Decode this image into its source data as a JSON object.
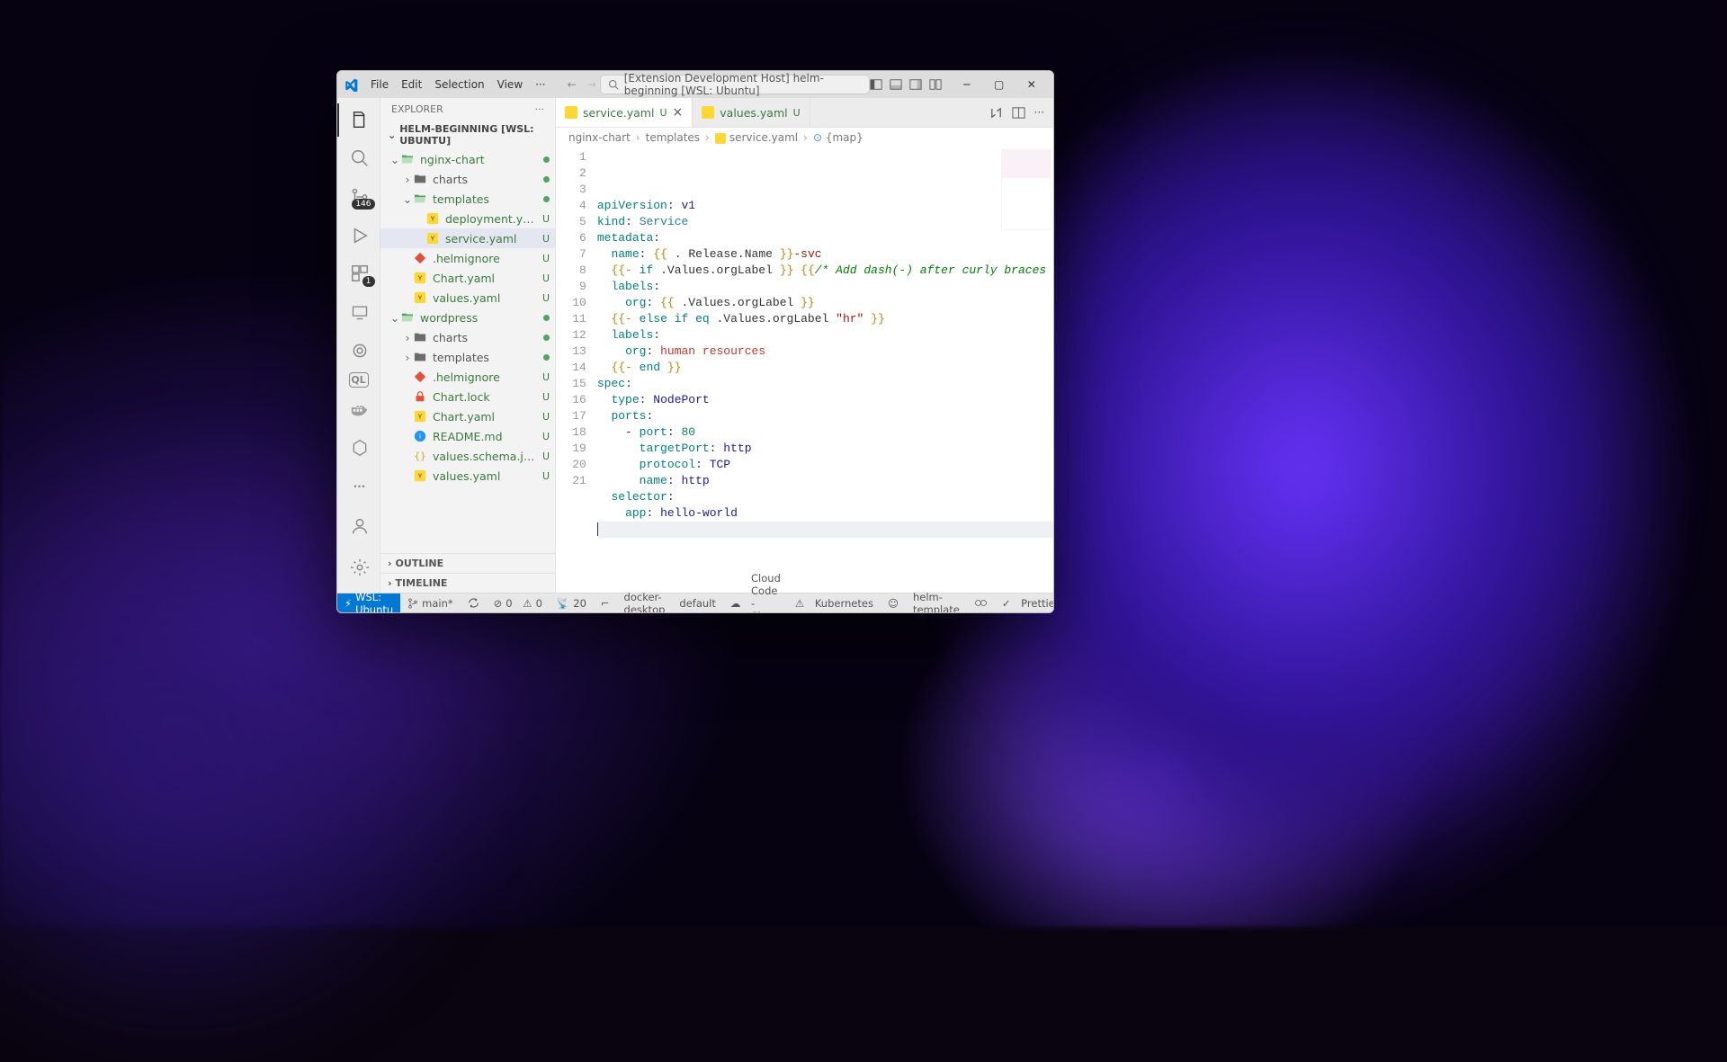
{
  "window": {
    "title_prefix": "[Extension Development Host]",
    "title_project": "helm-beginning",
    "title_remote": "[WSL: Ubuntu]"
  },
  "menu": {
    "file": "File",
    "edit": "Edit",
    "selection": "Selection",
    "view": "View"
  },
  "activity": {
    "scm_badge": "146",
    "ext_badge": "1"
  },
  "sidebar": {
    "title": "EXPLORER",
    "section": "HELM-BEGINNING [WSL: UBUNTU]",
    "outline": "OUTLINE",
    "timeline": "TIMELINE",
    "tree": [
      {
        "depth": 0,
        "kind": "folder-open",
        "label": "nginx-chart",
        "git": "dot",
        "col": "#3b7a3d"
      },
      {
        "depth": 1,
        "kind": "folder",
        "label": "charts",
        "git": "dot",
        "col": "#555"
      },
      {
        "depth": 1,
        "kind": "folder-open",
        "label": "templates",
        "git": "dot",
        "col": "#3b7a3d"
      },
      {
        "depth": 2,
        "kind": "yaml",
        "label": "deployment.yaml",
        "git": "U",
        "col": "#3b7a3d"
      },
      {
        "depth": 2,
        "kind": "yaml",
        "label": "service.yaml",
        "git": "U",
        "col": "#3b7a3d",
        "selected": true
      },
      {
        "depth": 1,
        "kind": "ignore",
        "label": ".helmignore",
        "git": "U",
        "col": "#3b7a3d"
      },
      {
        "depth": 1,
        "kind": "yaml",
        "label": "Chart.yaml",
        "git": "U",
        "col": "#3b7a3d"
      },
      {
        "depth": 1,
        "kind": "yaml",
        "label": "values.yaml",
        "git": "U",
        "col": "#3b7a3d"
      },
      {
        "depth": 0,
        "kind": "folder-open",
        "label": "wordpress",
        "git": "dot",
        "col": "#3b7a3d"
      },
      {
        "depth": 1,
        "kind": "folder",
        "label": "charts",
        "git": "dot",
        "col": "#555"
      },
      {
        "depth": 1,
        "kind": "folder",
        "label": "templates",
        "git": "dot",
        "col": "#555"
      },
      {
        "depth": 1,
        "kind": "ignore",
        "label": ".helmignore",
        "git": "U",
        "col": "#3b7a3d"
      },
      {
        "depth": 1,
        "kind": "lock",
        "label": "Chart.lock",
        "git": "U",
        "col": "#3b7a3d"
      },
      {
        "depth": 1,
        "kind": "yaml",
        "label": "Chart.yaml",
        "git": "U",
        "col": "#3b7a3d"
      },
      {
        "depth": 1,
        "kind": "md",
        "label": "README.md",
        "git": "U",
        "col": "#3b7a3d"
      },
      {
        "depth": 1,
        "kind": "json",
        "label": "values.schema.json",
        "git": "U",
        "col": "#3b7a3d"
      },
      {
        "depth": 1,
        "kind": "yaml",
        "label": "values.yaml",
        "git": "U",
        "col": "#3b7a3d"
      }
    ]
  },
  "tabs": [
    {
      "label": "service.yaml",
      "status": "U",
      "active": true,
      "close": true
    },
    {
      "label": "values.yaml",
      "status": "U",
      "active": false,
      "close": false
    }
  ],
  "breadcrumbs": [
    "nginx-chart",
    "templates",
    "service.yaml",
    "{map}"
  ],
  "code": {
    "lines": [
      [
        [
          "c-key",
          "apiVersion"
        ],
        [
          "",
          ":"
        ],
        [
          "",
          " "
        ],
        [
          "c-val",
          "v1"
        ]
      ],
      [
        [
          "c-key",
          "kind"
        ],
        [
          "",
          ":"
        ],
        [
          "",
          " "
        ],
        [
          "c-type",
          "Service"
        ]
      ],
      [
        [
          "c-key",
          "metadata"
        ],
        [
          "",
          ":"
        ]
      ],
      [
        [
          "",
          "  "
        ],
        [
          "c-key",
          "name"
        ],
        [
          "",
          ":"
        ],
        [
          "",
          " "
        ],
        [
          "c-tmpl",
          "{{ "
        ],
        [
          "",
          ". "
        ],
        [
          "",
          "Release.Name"
        ],
        [
          "c-tmpl",
          " }}"
        ],
        [
          "c-str",
          "-svc"
        ]
      ],
      [
        [
          "",
          "  "
        ],
        [
          "c-tmpl",
          "{{- "
        ],
        [
          "c-key",
          "if"
        ],
        [
          "",
          " "
        ],
        [
          "",
          ".Values.orgLabel"
        ],
        [
          "c-tmpl",
          " }}"
        ],
        [
          "",
          " "
        ],
        [
          "c-tmpl",
          "{{"
        ],
        [
          "c-cmt",
          "/* Add dash(-) after curly braces "
        ],
        [
          "",
          ""
        ]
      ],
      [
        [
          "",
          "  "
        ],
        [
          "c-key",
          "labels"
        ],
        [
          "",
          ":"
        ]
      ],
      [
        [
          "",
          "    "
        ],
        [
          "c-key",
          "org"
        ],
        [
          "",
          ":"
        ],
        [
          "",
          " "
        ],
        [
          "c-tmpl",
          "{{ "
        ],
        [
          "",
          ".Values.orgLabel"
        ],
        [
          "c-tmpl",
          " }}"
        ]
      ],
      [
        [
          "",
          "  "
        ],
        [
          "c-tmpl",
          "{{- "
        ],
        [
          "c-key",
          "else if eq"
        ],
        [
          "",
          " "
        ],
        [
          "",
          ".Values.orgLabel"
        ],
        [
          "",
          " "
        ],
        [
          "c-str",
          "\"hr\""
        ],
        [
          "c-tmpl",
          " }}"
        ]
      ],
      [
        [
          "",
          "  "
        ],
        [
          "c-key",
          "labels"
        ],
        [
          "",
          ":"
        ]
      ],
      [
        [
          "",
          "    "
        ],
        [
          "c-key",
          "org"
        ],
        [
          "",
          ":"
        ],
        [
          "",
          " "
        ],
        [
          "c-red",
          "human resources"
        ]
      ],
      [
        [
          "",
          "  "
        ],
        [
          "c-tmpl",
          "{{- "
        ],
        [
          "c-key",
          "end"
        ],
        [
          "c-tmpl",
          " }}"
        ]
      ],
      [
        [
          "c-key",
          "spec"
        ],
        [
          "",
          ":"
        ]
      ],
      [
        [
          "",
          "  "
        ],
        [
          "c-key",
          "type"
        ],
        [
          "",
          ":"
        ],
        [
          "",
          " "
        ],
        [
          "c-val",
          "NodePort"
        ]
      ],
      [
        [
          "",
          "  "
        ],
        [
          "c-key",
          "ports"
        ],
        [
          "",
          ":"
        ]
      ],
      [
        [
          "",
          "    - "
        ],
        [
          "c-key",
          "port"
        ],
        [
          "",
          ":"
        ],
        [
          "",
          " "
        ],
        [
          "c-num",
          "80"
        ]
      ],
      [
        [
          "",
          "      "
        ],
        [
          "c-key",
          "targetPort"
        ],
        [
          "",
          ":"
        ],
        [
          "",
          " "
        ],
        [
          "c-val",
          "http"
        ]
      ],
      [
        [
          "",
          "      "
        ],
        [
          "c-key",
          "protocol"
        ],
        [
          "",
          ":"
        ],
        [
          "",
          " "
        ],
        [
          "c-val",
          "TCP"
        ]
      ],
      [
        [
          "",
          "      "
        ],
        [
          "c-key",
          "name"
        ],
        [
          "",
          ":"
        ],
        [
          "",
          " "
        ],
        [
          "c-val",
          "http"
        ]
      ],
      [
        [
          "",
          "  "
        ],
        [
          "c-key",
          "selector"
        ],
        [
          "",
          ":"
        ]
      ],
      [
        [
          "",
          "    "
        ],
        [
          "c-key",
          "app"
        ],
        [
          "",
          ":"
        ],
        [
          "",
          " "
        ],
        [
          "c-val",
          "hello-world"
        ]
      ],
      [
        [
          "",
          ""
        ]
      ]
    ]
  },
  "status": {
    "remote": "WSL: Ubuntu",
    "branch": "main*",
    "sync": "",
    "errors": "0",
    "warnings": "0",
    "ports": "20",
    "k8s1": "docker-desktop",
    "k8s2": "default",
    "cloud": "Cloud Code - Sign in",
    "kube": "Kubernetes",
    "lang": "helm-template",
    "prettier": "Prettier"
  }
}
